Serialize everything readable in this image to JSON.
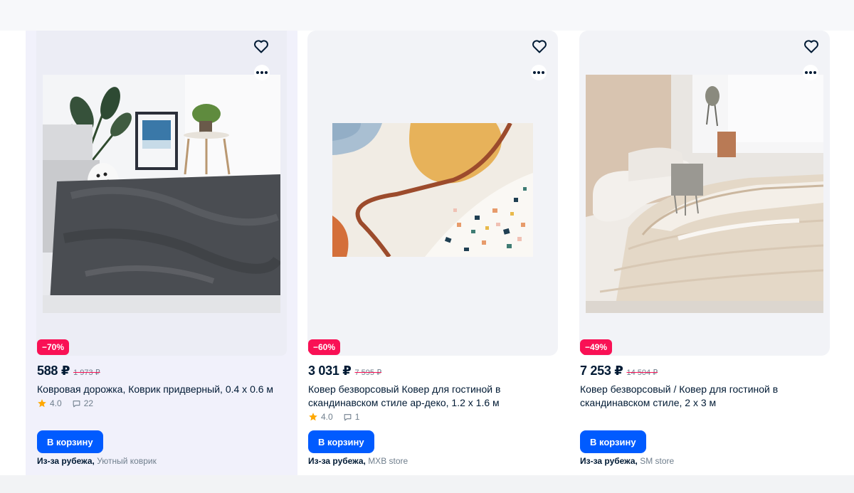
{
  "products": [
    {
      "discount": "−70%",
      "price": "588 ₽",
      "old_price": "1 973 ₽",
      "title": "Ковровая дорожка, Коврик придверный, 0.4 x 0.6 м",
      "rating": "4.0",
      "reviews": "22",
      "cart_label": "В корзину",
      "origin": "Из-за рубежа,",
      "seller": "Уютный коврик"
    },
    {
      "discount": "−60%",
      "price": "3 031 ₽",
      "old_price": "7 595 ₽",
      "title": "Ковер безворсовый Ковер для гостиной в скандинавском стиле ар-деко, 1.2 x 1.6 м",
      "rating": "4.0",
      "reviews": "1",
      "cart_label": "В корзину",
      "origin": "Из-за рубежа,",
      "seller": "MXB store"
    },
    {
      "discount": "−49%",
      "price": "7 253 ₽",
      "old_price": "14 504 ₽",
      "title": "Ковер безворсовый / Ковер для гостиной в скандинавском стиле, 2 x 3 м",
      "cart_label": "В корзину",
      "origin": "Из-за рубежа,",
      "seller": "SM store"
    }
  ],
  "icons": {
    "favorite": "heart-outline-icon",
    "more": "more-dots-icon",
    "rating": "star-icon",
    "reviews": "comment-icon"
  },
  "colors": {
    "accent": "#005bff",
    "discount": "#f91155",
    "star": "#ffa800",
    "text": "#001a34",
    "muted": "#707f8d"
  }
}
